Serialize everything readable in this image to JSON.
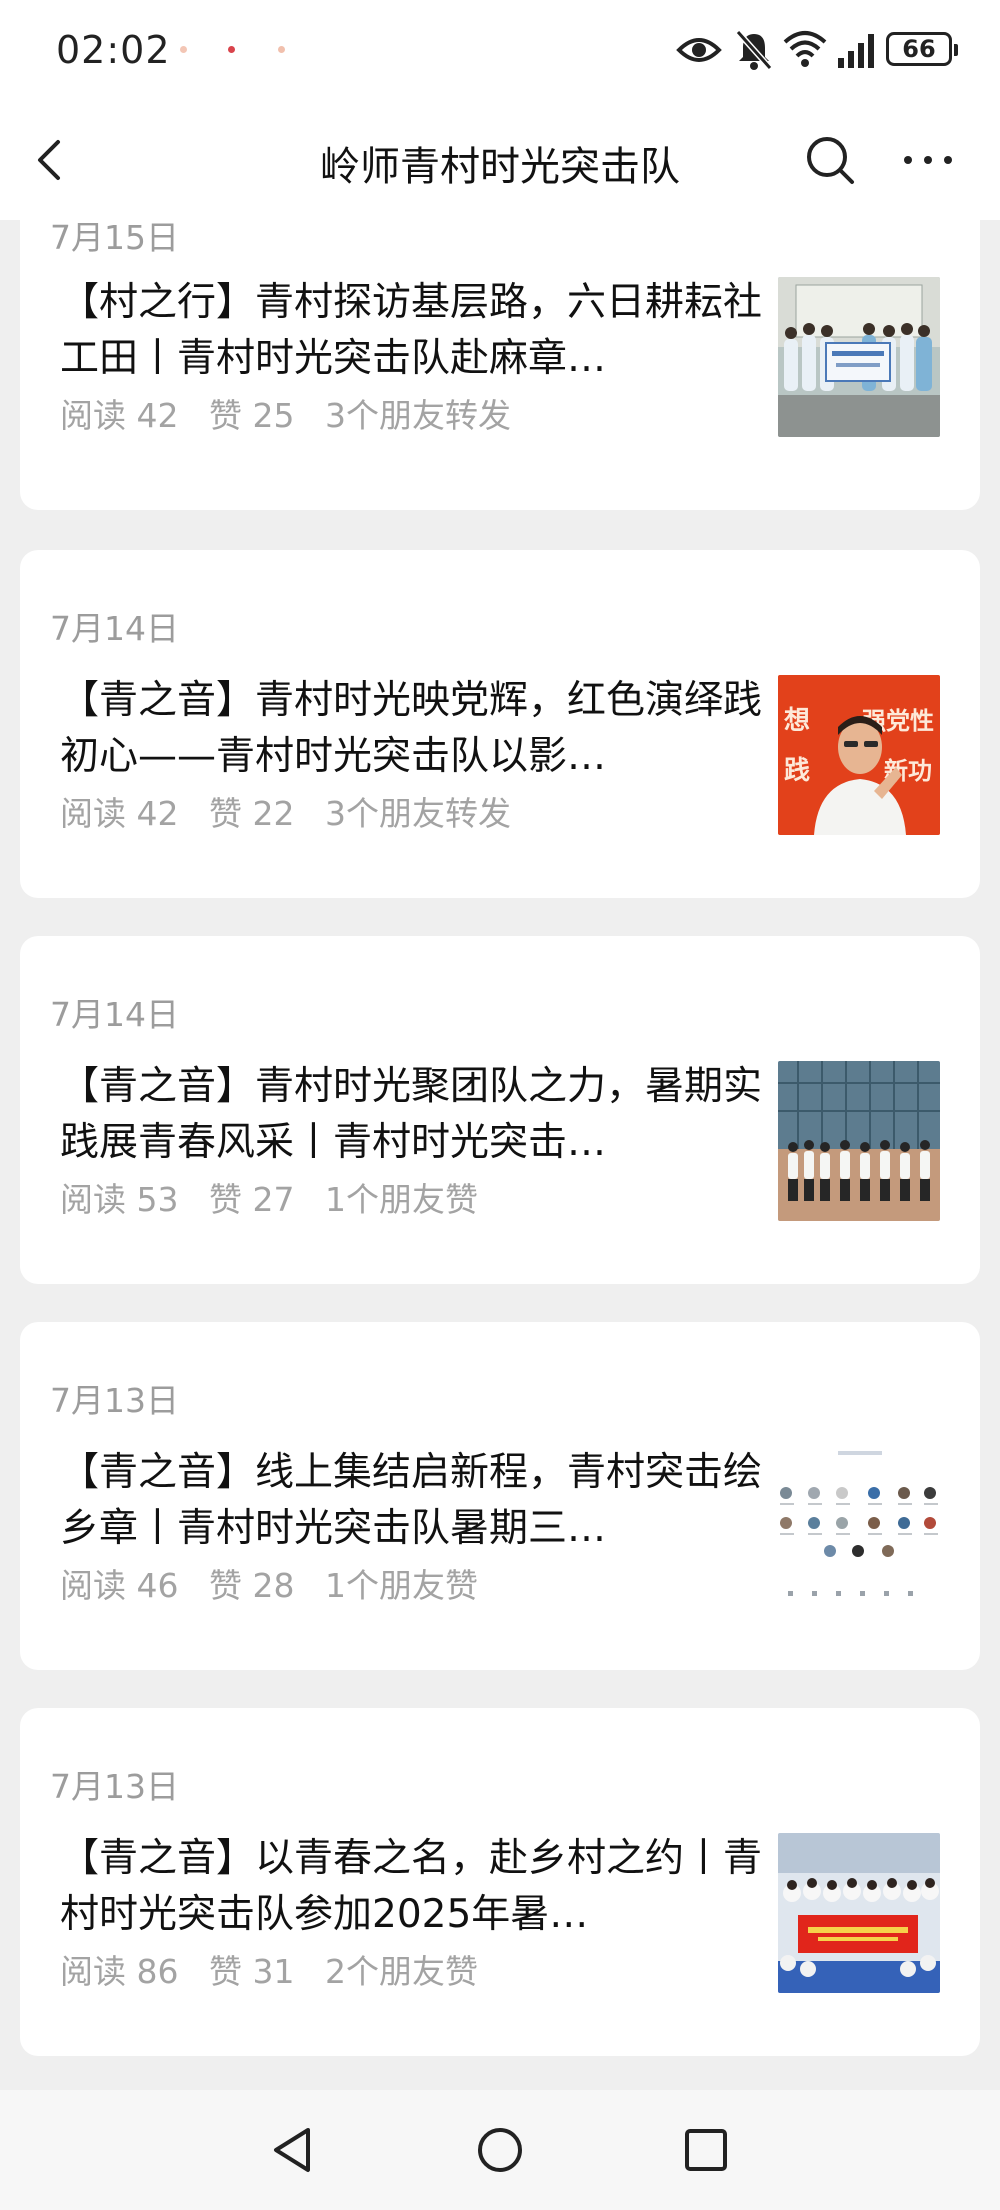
{
  "status_bar": {
    "time": "02:02",
    "battery": "66",
    "icons": [
      "eye-icon",
      "bell-muted-icon",
      "wifi-icon",
      "signal-icon",
      "battery-icon"
    ]
  },
  "nav": {
    "title": "岭师青村时光突击队",
    "icons": [
      "back-arrow-icon",
      "search-icon",
      "more-icon"
    ]
  },
  "articles": [
    {
      "date": "7月15日",
      "title": "【村之行】青村探访基层路，六日耕耘社工田丨青村时光突击队赴麻章…",
      "reads": "阅读 42",
      "likes": "赞 25",
      "social": "3个朋友转发"
    },
    {
      "date": "7月14日",
      "title": "【青之音】青村时光映党辉，红色演绎践初心——青村时光突击队以影…",
      "reads": "阅读 42",
      "likes": "赞 22",
      "social": "3个朋友转发"
    },
    {
      "date": "7月14日",
      "title": "【青之音】青村时光聚团队之力，暑期实践展青春风采丨青村时光突击…",
      "reads": "阅读 53",
      "likes": "赞 27",
      "social": "1个朋友赞"
    },
    {
      "date": "7月13日",
      "title": "【青之音】线上集结启新程，青村突击绘乡章丨青村时光突击队暑期三…",
      "reads": "阅读 46",
      "likes": "赞 28",
      "social": "1个朋友赞"
    },
    {
      "date": "7月13日",
      "title": "【青之音】以青春之名，赴乡村之约丨青村时光突击队参加2025年暑…",
      "reads": "阅读 86",
      "likes": "赞 31",
      "social": "2个朋友赞"
    }
  ],
  "thumb_text": {
    "banner_left_1": "想",
    "banner_left_2": "践",
    "banner_right_1": "强党性",
    "banner_right_2": "新功"
  },
  "system_nav": {
    "icons": [
      "back-triangle-icon",
      "home-circle-icon",
      "recents-square-icon"
    ]
  },
  "colors": {
    "background": "#efefef",
    "card": "#ffffff",
    "muted_text": "#a3a3a3",
    "date_text": "#9c9c9c"
  }
}
